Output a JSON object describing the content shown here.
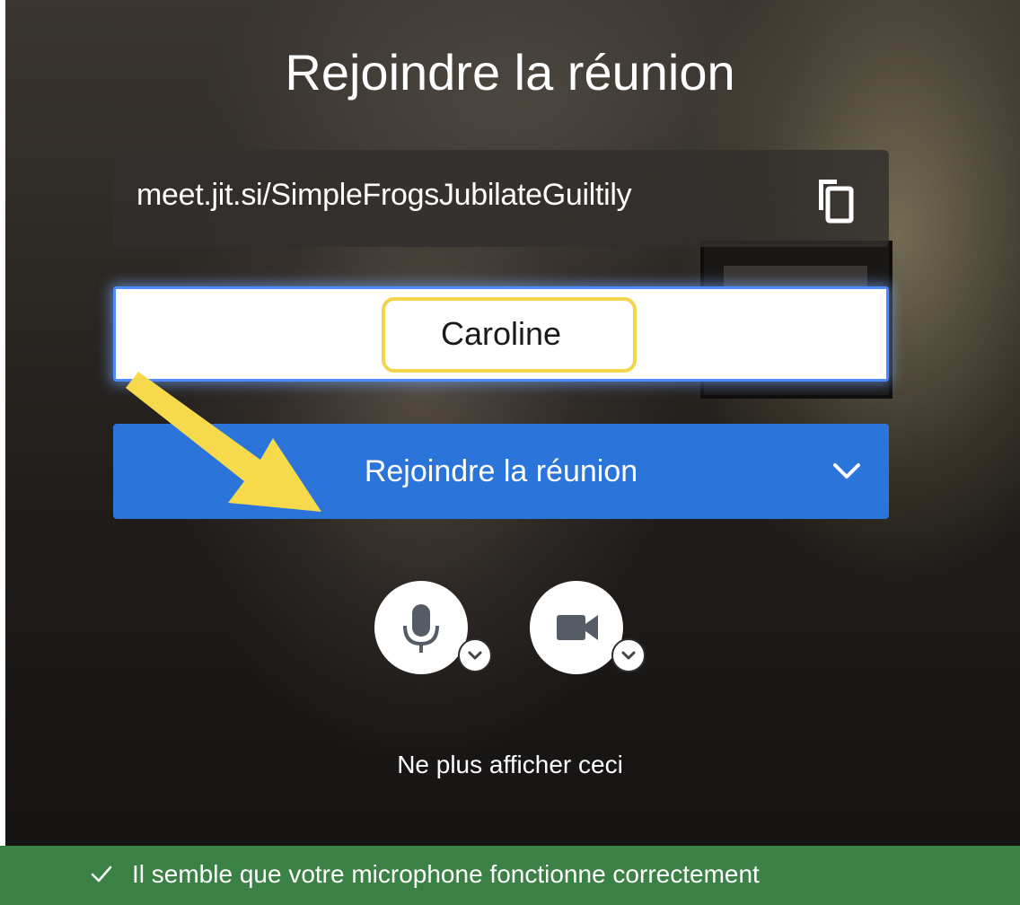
{
  "prejoin": {
    "title": "Rejoindre la réunion",
    "meeting_url": "meet.jit.si/SimpleFrogsJubilateGuiltily",
    "copy_icon": "copy-icon",
    "name_input": {
      "value": "Caroline",
      "placeholder": ""
    },
    "join_button": {
      "label": "Rejoindre la réunion",
      "chevron_icon": "chevron-down-icon"
    },
    "devices": {
      "microphone_icon": "microphone-icon",
      "camera_icon": "video-camera-icon",
      "caret_icon": "chevron-down-icon"
    },
    "dont_show_label": "Ne plus afficher ceci",
    "status": {
      "icon": "checkmark-icon",
      "text": "Il semble que votre microphone fonctionne correctement"
    }
  },
  "annotations": {
    "highlight_color": "#f2d54a",
    "arrow_color": "#f7d94c"
  },
  "colors": {
    "join_button": "#2a74da",
    "status_bar": "#3b8044",
    "input_focus": "#4e8bff"
  }
}
